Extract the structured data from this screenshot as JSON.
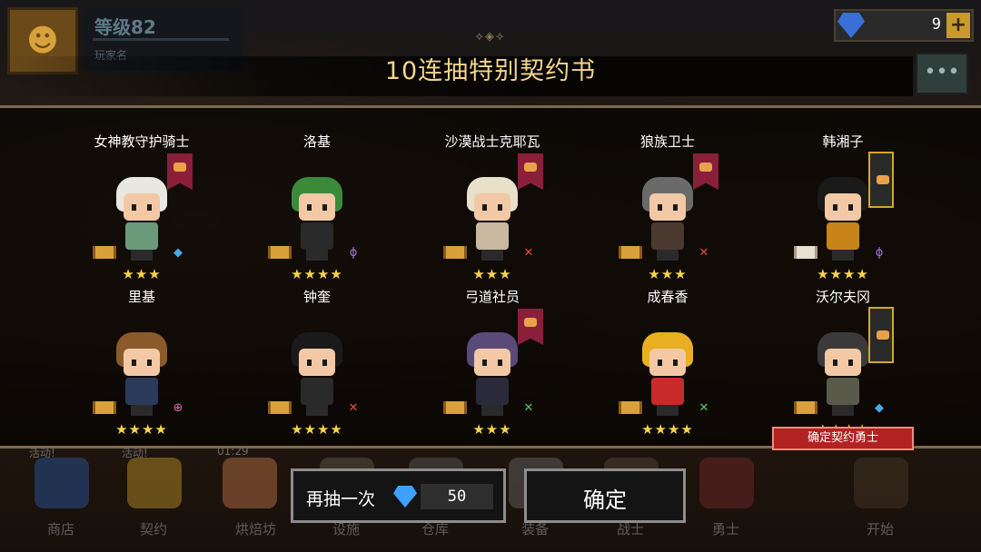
{
  "player": {
    "level": "等级82",
    "name": "玩家名"
  },
  "currency": {
    "gems": "9",
    "add": "+"
  },
  "chat": {
    "icon": "chat-bubble-icon"
  },
  "header": {
    "ornament": "⟡◈⟡",
    "title": "10连抽特别契约书"
  },
  "heroes": [
    {
      "name": "女神教守护骑士",
      "stars": "★★★",
      "class_icon": "blue-axe-icon",
      "banner": "red",
      "scroll": "gold",
      "hair": "#e8e8e0",
      "body": "#6b9a7a"
    },
    {
      "name": "洛基",
      "stars": "★★★★",
      "class_icon": "purple-staff-icon",
      "banner": "none",
      "scroll": "gold",
      "hair": "#3a8a3a",
      "body": "#2a2a2a"
    },
    {
      "name": "沙漠战士克耶瓦",
      "stars": "★★★",
      "class_icon": "red-swords-icon",
      "banner": "red",
      "scroll": "gold",
      "hair": "#e8e0c8",
      "body": "#c8b8a0"
    },
    {
      "name": "狼族卫士",
      "stars": "★★★",
      "class_icon": "red-swords-icon",
      "banner": "red",
      "scroll": "gold",
      "hair": "#6a6a6a",
      "body": "#4a3a30"
    },
    {
      "name": "韩湘子",
      "stars": "★★★★",
      "class_icon": "purple-staff-icon",
      "banner": "gold",
      "scroll": "white",
      "hair": "#1a1a1a",
      "body": "#c8841a"
    },
    {
      "name": "里基",
      "stars": "★★★★",
      "class_icon": "pink-target-icon",
      "banner": "none",
      "scroll": "gold",
      "hair": "#8a5a2a",
      "body": "#2a3a5a"
    },
    {
      "name": "钟奎",
      "stars": "★★★★",
      "class_icon": "red-swords-icon",
      "banner": "none",
      "scroll": "gold",
      "hair": "#1a1a1a",
      "body": "#2a2a2a"
    },
    {
      "name": "弓道社员",
      "stars": "★★★",
      "class_icon": "green-bow-icon",
      "banner": "red",
      "scroll": "gold",
      "hair": "#5a4a7a",
      "body": "#2a2a3a"
    },
    {
      "name": "成春香",
      "stars": "★★★★",
      "class_icon": "green-bow-icon",
      "banner": "none",
      "scroll": "gold",
      "hair": "#e8b020",
      "body": "#c82a2a"
    },
    {
      "name": "沃尔夫冈",
      "stars": "★★★★",
      "class_icon": "blue-axe-icon",
      "banner": "gold",
      "scroll": "gold",
      "hair": "#3a3a3a",
      "body": "#5a5a4a"
    }
  ],
  "confirm_tag": "确定契约勇士",
  "buttons": {
    "again_label": "再抽一次",
    "again_cost": "50",
    "confirm_label": "确定"
  },
  "nav": [
    {
      "label": "商店",
      "tag": "活动!"
    },
    {
      "label": "契约",
      "tag": "活动!"
    },
    {
      "label": "烘焙坊",
      "tag": "01:29"
    },
    {
      "label": "设施",
      "tag": ""
    },
    {
      "label": "仓库",
      "tag": ""
    },
    {
      "label": "装备",
      "tag": ""
    },
    {
      "label": "战士",
      "tag": ""
    },
    {
      "label": "勇士",
      "tag": ""
    },
    {
      "label": "开始",
      "tag": ""
    }
  ],
  "colors": {
    "title": "#f4d58a",
    "star": "#f6d34a",
    "accent_red": "#b22222"
  }
}
